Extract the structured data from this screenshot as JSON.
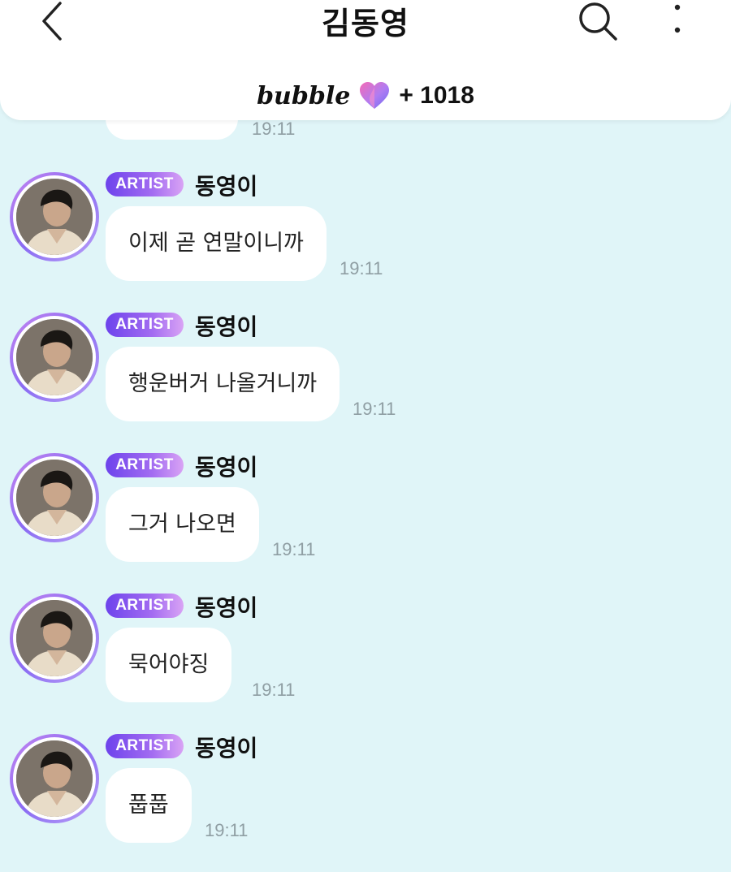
{
  "header": {
    "title": "김동영",
    "bubble_logo": "bubble",
    "bubble_count": "+ 1018",
    "back_icon": "chevron-left-icon",
    "search_icon": "search-icon",
    "more_icon": "more-vertical-icon"
  },
  "partial": {
    "time": "19:11"
  },
  "messages": [
    {
      "badge": "ARTIST",
      "sender": "동영이",
      "text": "이제 곧 연말이니까",
      "time": "19:11"
    },
    {
      "badge": "ARTIST",
      "sender": "동영이",
      "text": "행운버거 나올거니까",
      "time": "19:11"
    },
    {
      "badge": "ARTIST",
      "sender": "동영이",
      "text": "그거 나오면",
      "time": "19:11"
    },
    {
      "badge": "ARTIST",
      "sender": "동영이",
      "text": "묵어야징",
      "time": "19:11"
    },
    {
      "badge": "ARTIST",
      "sender": "동영이",
      "text": "풉풉",
      "time": "19:11"
    }
  ],
  "colors": {
    "background": "#e0f5f8",
    "badge_start": "#6d43ec",
    "badge_end": "#d9a3f5",
    "time": "#8f9ea3"
  }
}
